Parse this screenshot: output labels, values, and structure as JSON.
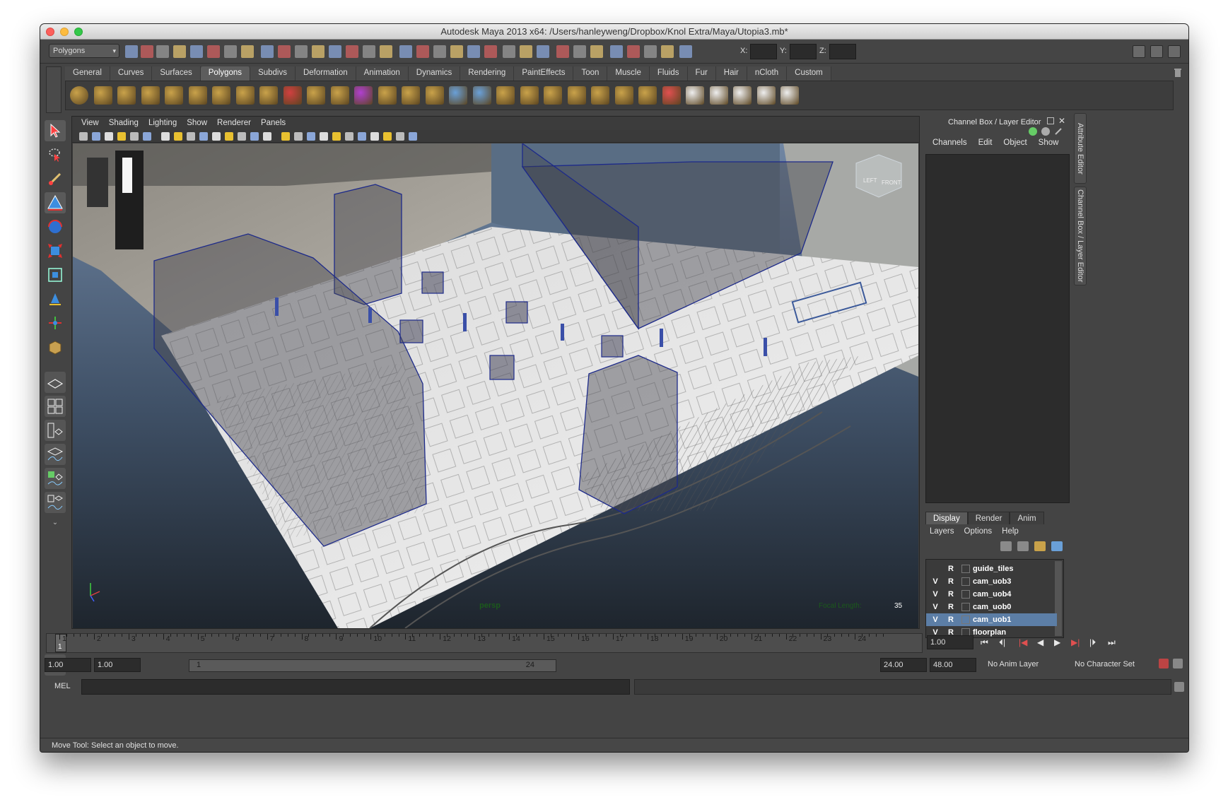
{
  "window": {
    "title": "Autodesk Maya 2013 x64: /Users/hanleyweng/Dropbox/Knol Extra/Maya/Utopia3.mb*"
  },
  "toolbar": {
    "menu_set": "Polygons",
    "x_label": "X:",
    "y_label": "Y:",
    "z_label": "Z:"
  },
  "shelf": {
    "tabs": [
      "General",
      "Curves",
      "Surfaces",
      "Polygons",
      "Subdivs",
      "Deformation",
      "Animation",
      "Dynamics",
      "Rendering",
      "PaintEffects",
      "Toon",
      "Muscle",
      "Fluids",
      "Fur",
      "Hair",
      "nCloth",
      "Custom"
    ],
    "active_tab": "Polygons"
  },
  "viewport": {
    "menu": [
      "View",
      "Shading",
      "Lighting",
      "Show",
      "Renderer",
      "Panels"
    ],
    "camera_label": "persp",
    "focal_label": "Focal Length:",
    "focal_value": "35",
    "view_cube_left": "LEFT",
    "view_cube_front": "FRONT"
  },
  "channel_box": {
    "title": "Channel Box / Layer Editor",
    "menu": [
      "Channels",
      "Edit",
      "Object",
      "Show"
    ]
  },
  "layer_editor": {
    "tabs": [
      "Display",
      "Render",
      "Anim"
    ],
    "active_tab": "Display",
    "menu": [
      "Layers",
      "Options",
      "Help"
    ],
    "layers": [
      {
        "v": "",
        "r": "R",
        "name": "guide_tiles",
        "selected": false
      },
      {
        "v": "V",
        "r": "R",
        "name": "cam_uob3",
        "selected": false
      },
      {
        "v": "V",
        "r": "R",
        "name": "cam_uob4",
        "selected": false
      },
      {
        "v": "V",
        "r": "R",
        "name": "cam_uob0",
        "selected": false
      },
      {
        "v": "V",
        "r": "R",
        "name": "cam_uob1",
        "selected": true
      },
      {
        "v": "V",
        "r": "R",
        "name": "floorplan",
        "selected": false
      }
    ]
  },
  "side_tabs": [
    "Attribute Editor",
    "Channel Box / Layer Editor"
  ],
  "timeline": {
    "ticks": [
      "1",
      "2",
      "3",
      "4",
      "5",
      "6",
      "7",
      "8",
      "9",
      "10",
      "11",
      "12",
      "13",
      "14",
      "15",
      "16",
      "17",
      "18",
      "19",
      "20",
      "21",
      "22",
      "23",
      "24"
    ],
    "current_frame_marker": "1",
    "current_time": "1.00"
  },
  "range": {
    "start_time": "1.00",
    "start_range": "1.00",
    "slider_start": "1",
    "slider_end": "24",
    "end_range": "24.00",
    "end_time": "48.00",
    "anim_layer": "No Anim Layer",
    "character_set": "No Character Set"
  },
  "command_line": {
    "label": "MEL"
  },
  "status_line": {
    "text": "Move Tool: Select an object to move."
  },
  "colors": {
    "window_bg": "#444444",
    "selection": "#5c7ea6",
    "wireframe": "#1d2a8a"
  }
}
